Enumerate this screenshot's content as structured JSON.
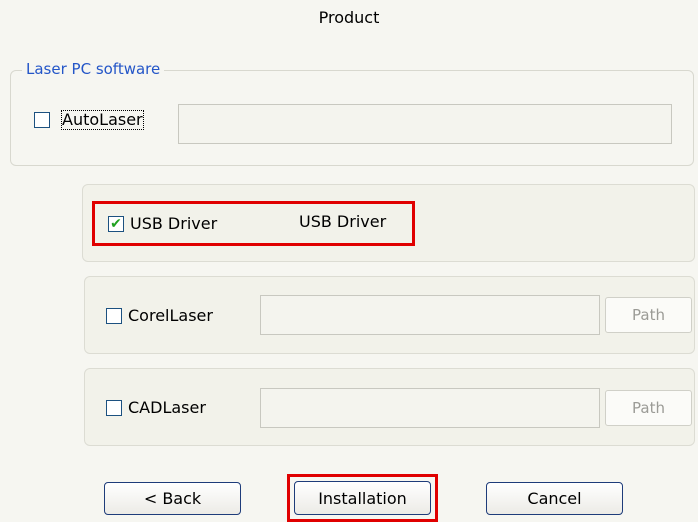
{
  "window": {
    "title": "Product"
  },
  "laser_group": {
    "legend": "Laser PC software",
    "autolaser": {
      "label": "AutoLaser",
      "checked": false,
      "field_value": ""
    }
  },
  "usb_driver": {
    "label": "USB Driver",
    "checked": true,
    "status": "USB Driver"
  },
  "corellaser": {
    "label": "CorelLaser",
    "checked": false,
    "path_value": "",
    "path_button": "Path"
  },
  "cadlaser": {
    "label": "CADLaser",
    "checked": false,
    "path_value": "",
    "path_button": "Path"
  },
  "buttons": {
    "back": "< Back",
    "install": "Installation",
    "cancel": "Cancel"
  },
  "colors": {
    "highlight": "#e00000",
    "legend": "#2456c8",
    "check": "#21a121"
  }
}
